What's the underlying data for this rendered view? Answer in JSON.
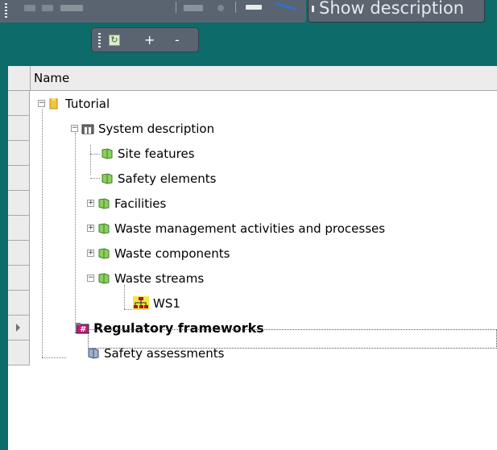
{
  "toolbar": {
    "show_description_label": "Show description",
    "add_label": "+",
    "remove_label": "-"
  },
  "grid": {
    "column_header": "Name",
    "nodes": [
      {
        "label": "Tutorial",
        "icon": "folder-icon",
        "expander": "minus"
      },
      {
        "label": "System description",
        "icon": "system-icon",
        "expander": "minus"
      },
      {
        "label": "Site features",
        "icon": "book-icon"
      },
      {
        "label": "Safety elements",
        "icon": "book-icon"
      },
      {
        "label": "Facilities",
        "icon": "book-icon",
        "expander": "plus"
      },
      {
        "label": "Waste management activities and processes",
        "icon": "book-icon",
        "expander": "plus"
      },
      {
        "label": "Waste components",
        "icon": "book-icon",
        "expander": "plus"
      },
      {
        "label": "Waste streams",
        "icon": "book-icon",
        "expander": "minus"
      },
      {
        "label": "WS1",
        "icon": "waste-stream-icon"
      },
      {
        "label": "Regulatory frameworks",
        "icon": "regulatory-icon",
        "selected": true
      },
      {
        "label": "Safety assessments",
        "icon": "assessment-icon"
      }
    ]
  },
  "colors": {
    "toolbar_background": "#0d6b6a",
    "toolbar_panel": "#5a6470",
    "header_background": "#ececec"
  }
}
